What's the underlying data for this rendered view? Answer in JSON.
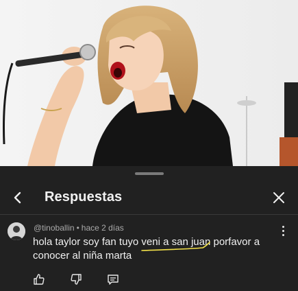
{
  "video": {
    "description_icon": "video-thumbnail"
  },
  "sheet": {
    "title": "Respuestas",
    "back_icon": "back-arrow-icon",
    "close_icon": "close-icon"
  },
  "comment": {
    "author": "@tinoballin",
    "separator": "•",
    "time": "hace 2 días",
    "text": "hola taylor soy fan tuyo veni a san juan porfavor a conocer al niña marta",
    "highlight_color": "#f4e24a",
    "actions": [
      {
        "icon": "thumbs-up-icon"
      },
      {
        "icon": "thumbs-down-icon"
      },
      {
        "icon": "reply-icon"
      }
    ]
  },
  "colors": {
    "sheet_bg": "#212121",
    "text_primary": "#f1f1f1",
    "text_secondary": "#aaaaaa"
  }
}
